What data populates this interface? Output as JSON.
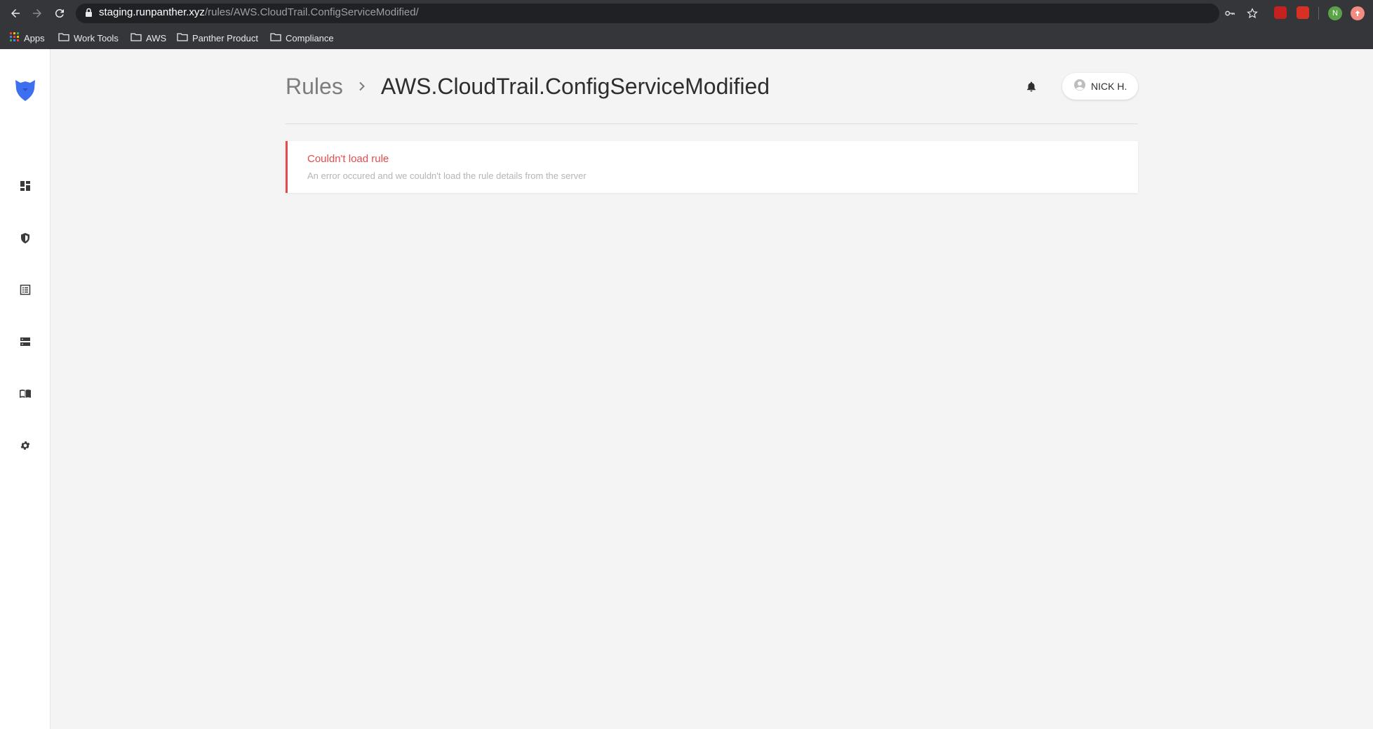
{
  "browser": {
    "url_host": "staging.runpanther.xyz",
    "url_path": "/rules/AWS.CloudTrail.ConfigServiceModified/",
    "profile_initial": "N",
    "bookmarks": [
      {
        "label": "Apps",
        "icon": "apps-grid-icon"
      },
      {
        "label": "Work Tools",
        "icon": "folder-icon"
      },
      {
        "label": "AWS",
        "icon": "folder-icon"
      },
      {
        "label": "Panther Product",
        "icon": "folder-icon"
      },
      {
        "label": "Compliance",
        "icon": "folder-icon"
      }
    ]
  },
  "sidebar": {
    "logo": "panther-logo",
    "items": [
      {
        "icon": "dashboard-icon"
      },
      {
        "icon": "shield-icon"
      },
      {
        "icon": "list-icon"
      },
      {
        "icon": "storage-icon"
      },
      {
        "icon": "book-icon"
      },
      {
        "icon": "gear-icon"
      }
    ]
  },
  "header": {
    "breadcrumb_parent": "Rules",
    "breadcrumb_current": "AWS.CloudTrail.ConfigServiceModified",
    "user_name": "NICK H."
  },
  "alert": {
    "title": "Couldn't load rule",
    "description": "An error occured and we couldn't load the rule details from the server"
  },
  "colors": {
    "accent": "#3d6ff0",
    "error": "#e64a4a",
    "background": "#f4f4f4"
  }
}
